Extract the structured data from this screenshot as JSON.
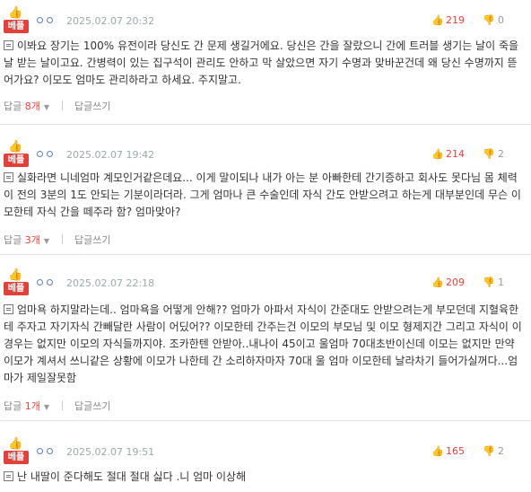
{
  "comments": [
    {
      "badge": "베플",
      "date": "2025.02.07 20:32",
      "likes": "219",
      "dislikes": "0",
      "text": "이봐요 장기는 100% 유전이라 당신도 간 문제 생길거에요. 당신은 간을 잘랐으니 간에 트러블 생기는 날이 죽을 날 받는 날이고요. 간병력이 있는 집구석이 관리도 안하고 막 살았으면 자기 수명과 맞바꾼건데 왜 당신 수명까지 뜯어가요? 이모도 엄마도 관리하라고 하세요. 주지말고.",
      "reply_label": "답글",
      "reply_count": "8개",
      "write_reply": "답글쓰기"
    },
    {
      "badge": "베플",
      "date": "2025.02.07 19:42",
      "likes": "214",
      "dislikes": "2",
      "text": "실화라면 니네엄마 계모인거같은데요... 이게 말이되나 내가 아는 분 아빠한테 간기증하고 회사도 못다님 몸 체력이 전의 3분의 1도 안되는 기분이라더라. 그게 엄마나 큰 수술인데 자식 간도 안받으려고 하는게 대부분인데 무슨 이모한테 자식 간을 떼주라 함? 엄마맞아?",
      "reply_label": "답글",
      "reply_count": "3개",
      "write_reply": "답글쓰기"
    },
    {
      "badge": "베플",
      "date": "2025.02.07 22:18",
      "likes": "209",
      "dislikes": "1",
      "text": "엄마욕 하지말라는데.. 엄마욕을 어떻게 안해?? 엄마가 아파서 자식이 간준대도 안받으려는게 부모던데 지혈육한테 주자고 자기자식 간빼달란 사람이 어딨어?? 이모한테 간주는건 이모의 부모님 및 이모 형제지간 그리고 자식이 이경우는 없지만 이모의 자식들까지야. 조카한텐 안받아..내나이 45이고 울엄마 70대초반이신데 이모는 없지만 만약 이모가 계셔서 쓰니같은 상황에 이모가 나한테 간 소리하자마자 70대 울 엄마 이모한테 날라차기 들어가실꺼다...엄마가 제일잘못함",
      "reply_label": "답글",
      "reply_count": "1개",
      "write_reply": "답글쓰기"
    },
    {
      "badge": "베플",
      "date": "2025.02.07 19:51",
      "likes": "165",
      "dislikes": "2",
      "text": "난 내딸이 준다해도 절대 절대 싫다 .니 엄마 이상해"
    }
  ]
}
